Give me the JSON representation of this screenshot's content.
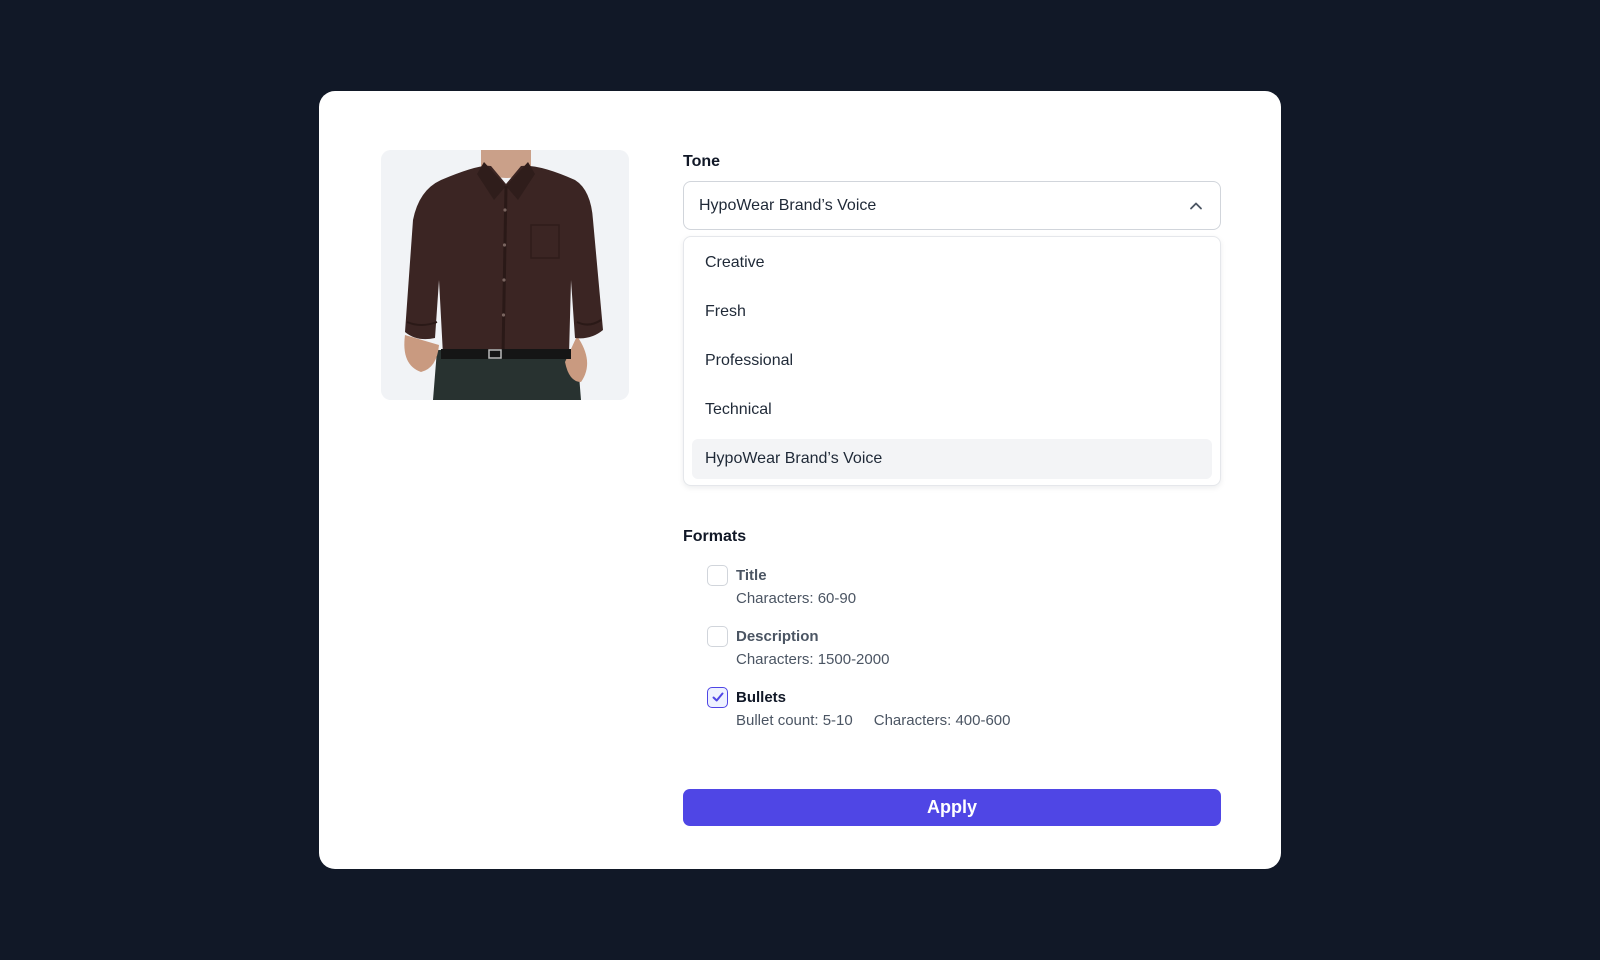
{
  "product": {
    "image_alt": "Man wearing a dark brown button-down shirt"
  },
  "tone": {
    "label": "Tone",
    "selected": "HypoWear Brand’s Voice",
    "options": [
      {
        "label": "Creative",
        "selected": false
      },
      {
        "label": "Fresh",
        "selected": false
      },
      {
        "label": "Professional",
        "selected": false
      },
      {
        "label": "Technical",
        "selected": false
      },
      {
        "label": "HypoWear Brand’s Voice",
        "selected": true
      }
    ]
  },
  "formats": {
    "label": "Formats",
    "items": [
      {
        "name": "Title",
        "checked": false,
        "meta": [
          "Characters: 60-90"
        ]
      },
      {
        "name": "Description",
        "checked": false,
        "meta": [
          "Characters: 1500-2000"
        ]
      },
      {
        "name": "Bullets",
        "checked": true,
        "meta": [
          "Bullet count: 5-10",
          "Characters: 400-600"
        ]
      }
    ]
  },
  "apply_label": "Apply",
  "colors": {
    "background": "#111827",
    "accent": "#4f46e5",
    "card": "#ffffff"
  },
  "icons": {
    "chevron": "chevron-up-icon",
    "check": "check-icon"
  }
}
